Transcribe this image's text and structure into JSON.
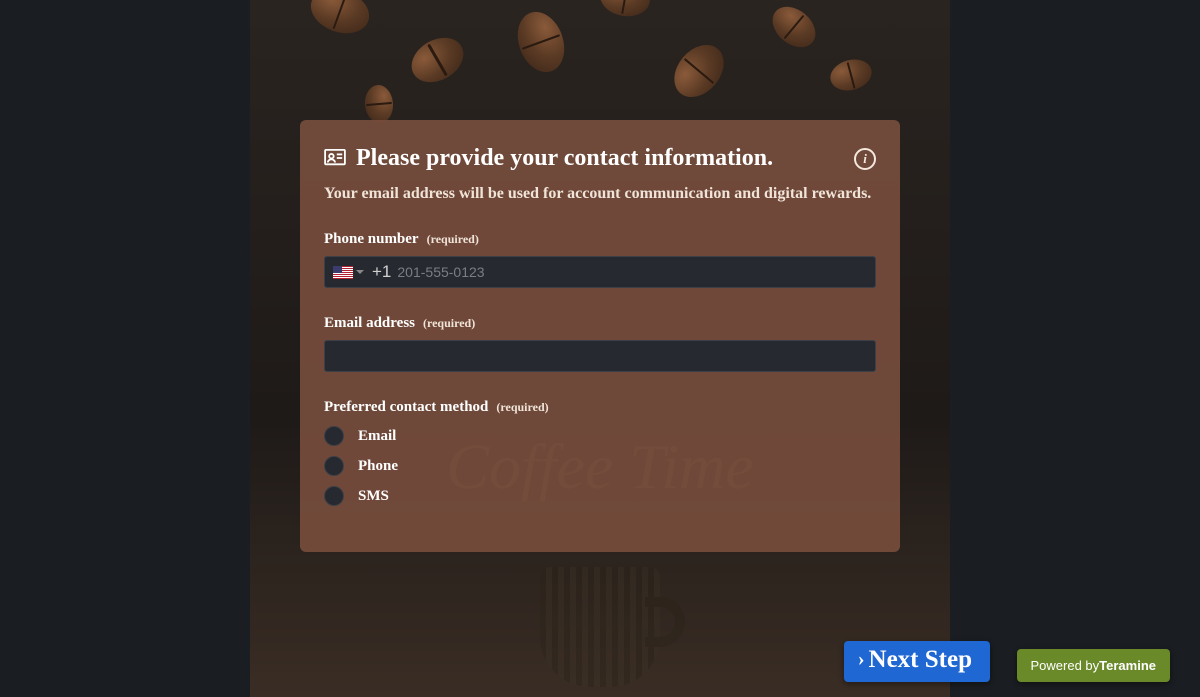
{
  "background": {
    "decorative_text": "Coffee Time"
  },
  "form": {
    "title": "Please provide your contact information.",
    "subtitle": "Your email address will be used for account communication and digital rewards.",
    "required_text": "(required)",
    "phone": {
      "label": "Phone number",
      "dial_code": "+1",
      "placeholder": "201-555-0123",
      "value": ""
    },
    "email": {
      "label": "Email address",
      "value": ""
    },
    "contact_method": {
      "label": "Preferred contact method",
      "options": [
        "Email",
        "Phone",
        "SMS"
      ]
    }
  },
  "footer": {
    "next_label": "Next Step",
    "powered_prefix": "Powered by",
    "powered_brand": "Teramine"
  }
}
